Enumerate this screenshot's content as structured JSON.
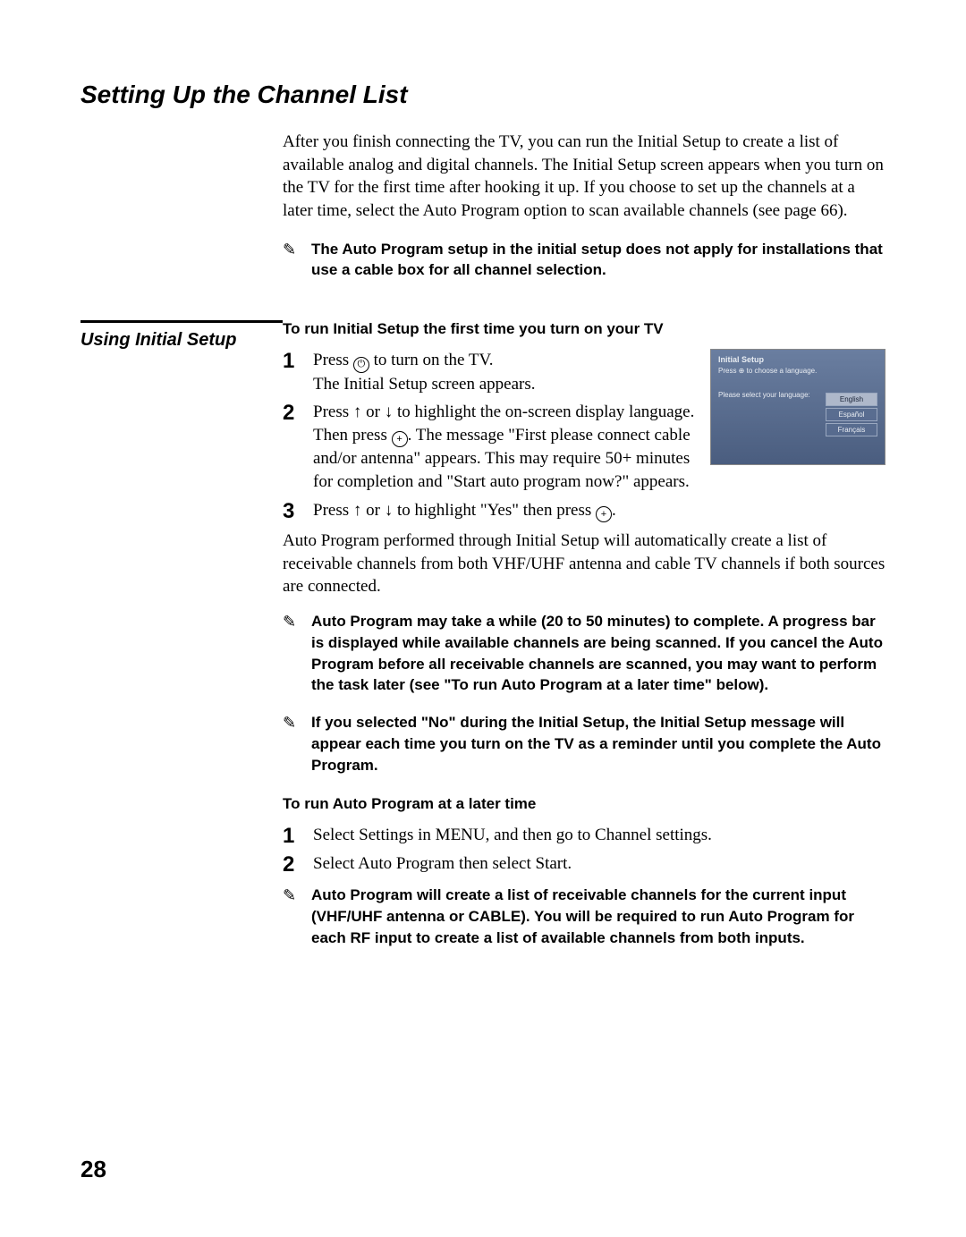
{
  "title": "Setting Up the Channel List",
  "intro": "After you finish connecting the TV, you can run the Initial Setup to create a list of available analog and digital channels. The Initial Setup screen appears when you turn on the TV for the first time after hooking it up. If you choose to set up the channels at a later time, select the Auto Program option to scan available channels (see page 66).",
  "note_top": "The Auto Program setup in the initial setup does not apply for installations that use a cable box for all channel selection.",
  "section": {
    "side_heading": "Using Initial Setup",
    "heading1": "To run Initial Setup the first time you turn on your TV",
    "steps1": {
      "s1a": "Press ",
      "s1b": " to turn on the TV.",
      "s1c": "The Initial Setup screen appears.",
      "s2a": "Press ",
      "s2b": " or ",
      "s2c": " to highlight the on-screen display language. Then press ",
      "s2d": ". The message \"First please connect cable and/or antenna\" appears. This may require 50+ minutes for completion and \"Start auto program now?\" appears.",
      "s3a": "Press ",
      "s3b": " or ",
      "s3c": " to highlight \"Yes\" then press ",
      "s3d": "."
    },
    "screen": {
      "title": "Initial Setup",
      "sub": "Press ⊕ to choose a language.",
      "prompt": "Please select your language:",
      "langs": [
        "English",
        "Español",
        "Français"
      ]
    },
    "after_steps": "Auto Program performed through Initial Setup will automatically create a list of receivable channels from both VHF/UHF antenna and cable TV channels if both sources are connected.",
    "note_mid1": "Auto Program may take a while (20 to 50 minutes) to complete. A progress bar is displayed while available channels are being scanned. If you cancel the Auto Program before all receivable channels are scanned, you may want to perform the task later (see \"To run Auto Program at a later time\"  below).",
    "note_mid2": "If you selected \"No\" during the Initial Setup, the Initial Setup message will appear each time you turn on the TV as a reminder until you complete the Auto Program.",
    "heading2": "To run Auto Program at a later time",
    "steps2": {
      "s1": "Select Settings in MENU, and then go to Channel settings.",
      "s2": "Select Auto Program then select Start."
    },
    "note_bottom": "Auto Program will create a list of receivable channels for the current input (VHF/UHF antenna or CABLE). You will be required to run Auto Program for each RF input to create a list of available channels from both inputs."
  },
  "page_number": "28"
}
